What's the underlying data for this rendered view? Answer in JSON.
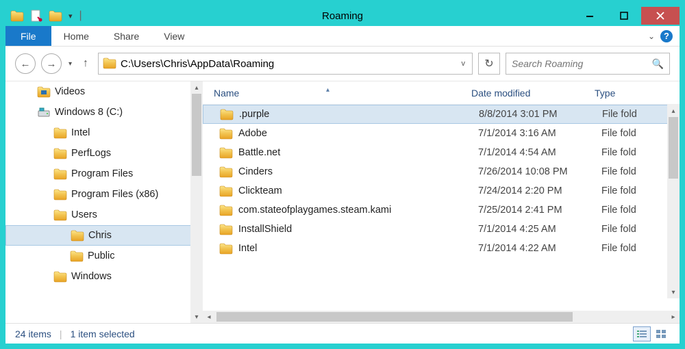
{
  "title": "Roaming",
  "ribbon": {
    "file": "File",
    "tabs": [
      "Home",
      "Share",
      "View"
    ]
  },
  "address": {
    "path": "C:\\Users\\Chris\\AppData\\Roaming"
  },
  "search": {
    "placeholder": "Search Roaming"
  },
  "tree": [
    {
      "label": "Videos",
      "kind": "videos",
      "indent": 1
    },
    {
      "label": "Windows 8 (C:)",
      "kind": "drive",
      "indent": 1
    },
    {
      "label": "Intel",
      "kind": "folder",
      "indent": 2
    },
    {
      "label": "PerfLogs",
      "kind": "folder",
      "indent": 2
    },
    {
      "label": "Program Files",
      "kind": "folder",
      "indent": 2
    },
    {
      "label": "Program Files (x86)",
      "kind": "folder",
      "indent": 2
    },
    {
      "label": "Users",
      "kind": "folder",
      "indent": 2
    },
    {
      "label": "Chris",
      "kind": "folder",
      "indent": 3,
      "selected": true
    },
    {
      "label": "Public",
      "kind": "folder",
      "indent": 3
    },
    {
      "label": "Windows",
      "kind": "folder",
      "indent": 2
    }
  ],
  "columns": {
    "name": "Name",
    "date": "Date modified",
    "type": "Type"
  },
  "rows": [
    {
      "name": ".purple",
      "date": "8/8/2014 3:01 PM",
      "type": "File fold",
      "selected": true
    },
    {
      "name": "Adobe",
      "date": "7/1/2014 3:16 AM",
      "type": "File fold"
    },
    {
      "name": "Battle.net",
      "date": "7/1/2014 4:54 AM",
      "type": "File fold"
    },
    {
      "name": "Cinders",
      "date": "7/26/2014 10:08 PM",
      "type": "File fold"
    },
    {
      "name": "Clickteam",
      "date": "7/24/2014 2:20 PM",
      "type": "File fold"
    },
    {
      "name": "com.stateofplaygames.steam.kami",
      "date": "7/25/2014 2:41 PM",
      "type": "File fold"
    },
    {
      "name": "InstallShield",
      "date": "7/1/2014 4:25 AM",
      "type": "File fold"
    },
    {
      "name": "Intel",
      "date": "7/1/2014 4:22 AM",
      "type": "File fold"
    }
  ],
  "status": {
    "items": "24 items",
    "selected": "1 item selected"
  }
}
